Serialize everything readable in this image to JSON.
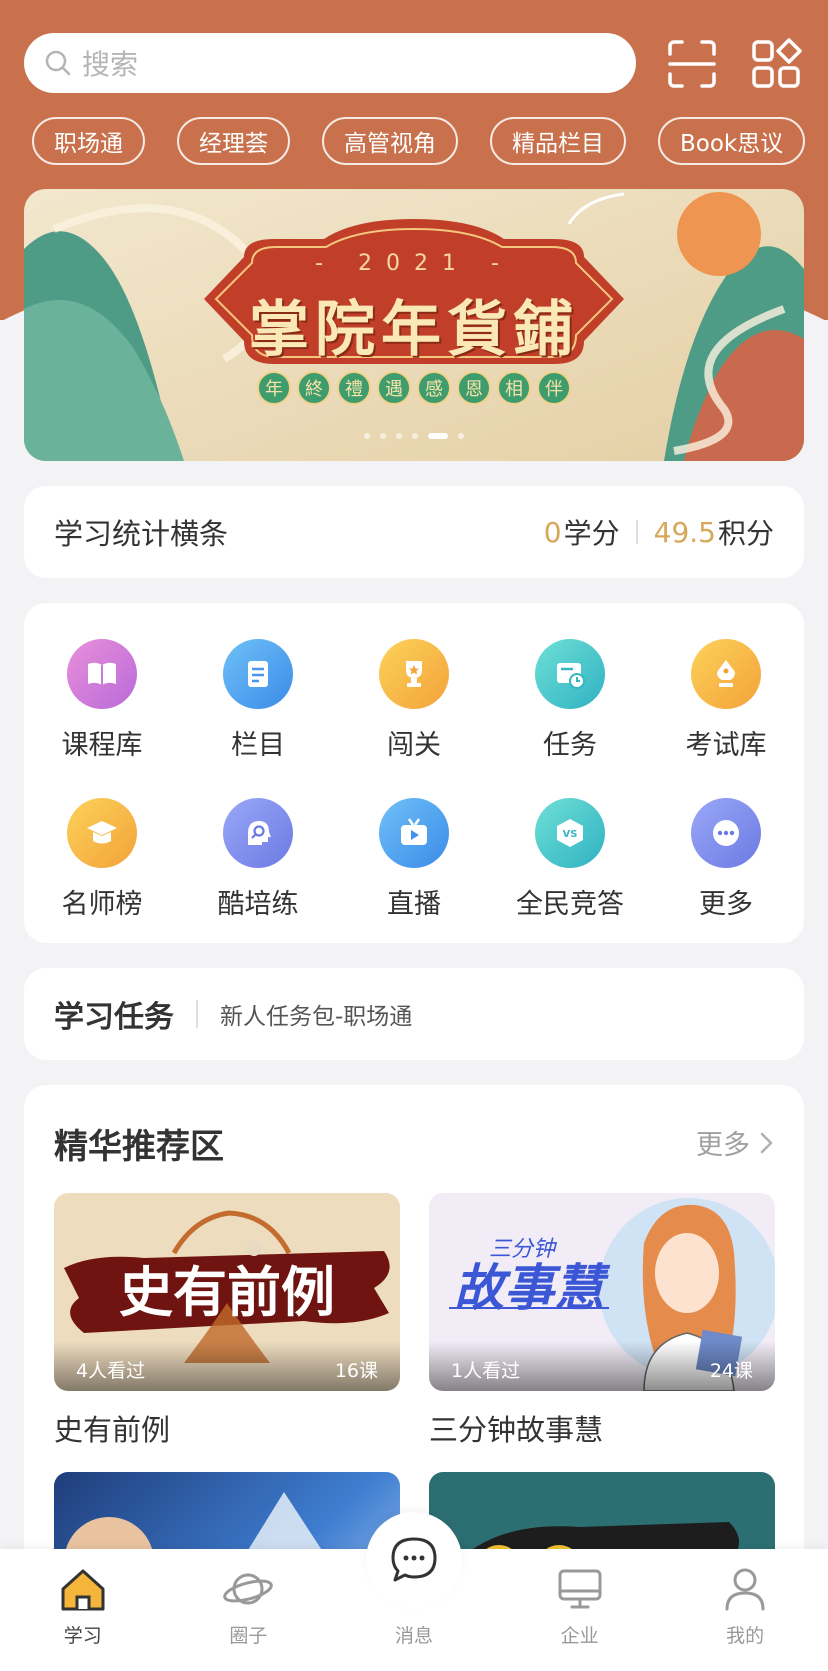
{
  "search": {
    "placeholder": "搜索"
  },
  "chips": [
    "职场通",
    "经理荟",
    "高管视角",
    "精品栏目",
    "Book思议"
  ],
  "banner": {
    "year": "- 2021 -",
    "title": "掌院年貨鋪",
    "subtitle_chars": [
      "年",
      "終",
      "禮",
      "遇",
      "感",
      "恩",
      "相",
      "伴"
    ],
    "slide_count": 6,
    "active_slide": 5
  },
  "stats": {
    "title": "学习统计横条",
    "credits_value": "0",
    "credits_unit": "学分",
    "points_value": "49.5",
    "points_unit": "积分"
  },
  "grid": [
    {
      "label": "课程库",
      "icon": "book-icon"
    },
    {
      "label": "栏目",
      "icon": "document-icon"
    },
    {
      "label": "闯关",
      "icon": "trophy-icon"
    },
    {
      "label": "任务",
      "icon": "task-clock-icon"
    },
    {
      "label": "考试库",
      "icon": "pen-nib-icon"
    },
    {
      "label": "名师榜",
      "icon": "graduation-cap-icon"
    },
    {
      "label": "酷培练",
      "icon": "head-search-icon"
    },
    {
      "label": "直播",
      "icon": "tv-icon"
    },
    {
      "label": "全民竞答",
      "icon": "vs-badge-icon"
    },
    {
      "label": "更多",
      "icon": "more-dots-icon"
    }
  ],
  "task": {
    "title": "学习任务",
    "text": "新人任务包-职场通"
  },
  "recommend": {
    "title": "精华推荐区",
    "more": "更多",
    "courses": [
      {
        "name": "史有前例",
        "views": "4人看过",
        "lessons": "16课",
        "thumb_text": "史有前例"
      },
      {
        "name": "三分钟故事慧",
        "views": "1人看过",
        "lessons": "24课",
        "thumb_text": "故事慧",
        "thumb_small": "三分钟"
      }
    ]
  },
  "tabbar": [
    {
      "label": "学习",
      "icon": "home-icon",
      "active": true
    },
    {
      "label": "圈子",
      "icon": "planet-icon",
      "active": false
    },
    {
      "label": "消息",
      "icon": "message-icon",
      "active": false
    },
    {
      "label": "企业",
      "icon": "monitor-icon",
      "active": false
    },
    {
      "label": "我的",
      "icon": "person-icon",
      "active": false
    }
  ],
  "colors": {
    "header": "#c8714c",
    "gold": "#d6a85a"
  }
}
